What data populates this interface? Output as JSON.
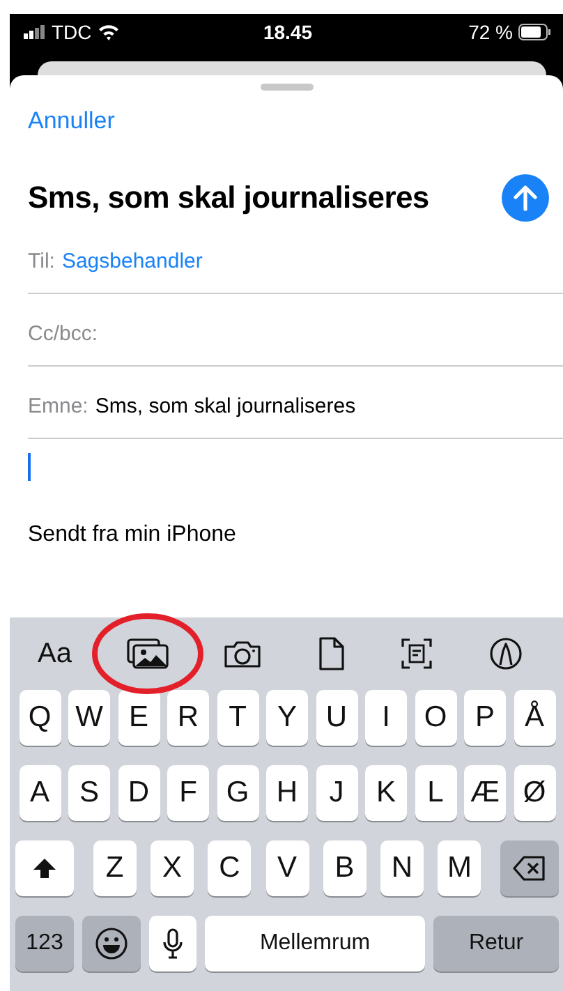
{
  "status_bar": {
    "carrier": "TDC",
    "time": "18.45",
    "battery": "72 %"
  },
  "compose": {
    "cancel": "Annuller",
    "title": "Sms, som skal journaliseres",
    "fields": [
      {
        "label": "Til:",
        "value": "Sagsbehandler",
        "kind": "recipient"
      },
      {
        "label": "Cc/bcc:",
        "kind": "plain"
      },
      {
        "label": "Emne:",
        "value": "Sms, som skal journaliseres",
        "kind": "plain"
      }
    ],
    "signature": "Sendt fra min iPhone"
  },
  "toolbar": {
    "format_label": "Aa"
  },
  "keyboard": {
    "rows": [
      {
        "keys": [
          {
            "kind": "letter",
            "label": "Q"
          },
          {
            "kind": "letter",
            "label": "W"
          },
          {
            "kind": "letter",
            "label": "E"
          },
          {
            "kind": "letter",
            "label": "R"
          },
          {
            "kind": "letter",
            "label": "T"
          },
          {
            "kind": "letter",
            "label": "Y"
          },
          {
            "kind": "letter",
            "label": "U"
          },
          {
            "kind": "letter",
            "label": "I"
          },
          {
            "kind": "letter",
            "label": "O"
          },
          {
            "kind": "letter",
            "label": "P"
          },
          {
            "kind": "letter",
            "label": "Å"
          }
        ]
      },
      {
        "keys": [
          {
            "kind": "letter",
            "label": "A"
          },
          {
            "kind": "letter",
            "label": "S"
          },
          {
            "kind": "letter",
            "label": "D"
          },
          {
            "kind": "letter",
            "label": "F"
          },
          {
            "kind": "letter",
            "label": "G"
          },
          {
            "kind": "letter",
            "label": "H"
          },
          {
            "kind": "letter",
            "label": "J"
          },
          {
            "kind": "letter",
            "label": "K"
          },
          {
            "kind": "letter",
            "label": "L"
          },
          {
            "kind": "letter",
            "label": "Æ"
          },
          {
            "kind": "letter",
            "label": "Ø"
          }
        ]
      },
      {
        "keys": [
          {
            "kind": "shift"
          },
          {
            "kind": "letter",
            "label": "Z"
          },
          {
            "kind": "letter",
            "label": "X"
          },
          {
            "kind": "letter",
            "label": "C"
          },
          {
            "kind": "letter",
            "label": "V"
          },
          {
            "kind": "letter",
            "label": "B"
          },
          {
            "kind": "letter",
            "label": "N"
          },
          {
            "kind": "letter",
            "label": "M"
          },
          {
            "kind": "delete"
          }
        ]
      },
      {
        "keys": [
          {
            "kind": "numbers",
            "label": "123"
          },
          {
            "kind": "emoji"
          },
          {
            "kind": "mic"
          },
          {
            "kind": "space",
            "label": "Mellemrum"
          },
          {
            "kind": "return",
            "label": "Retur"
          }
        ]
      }
    ]
  }
}
